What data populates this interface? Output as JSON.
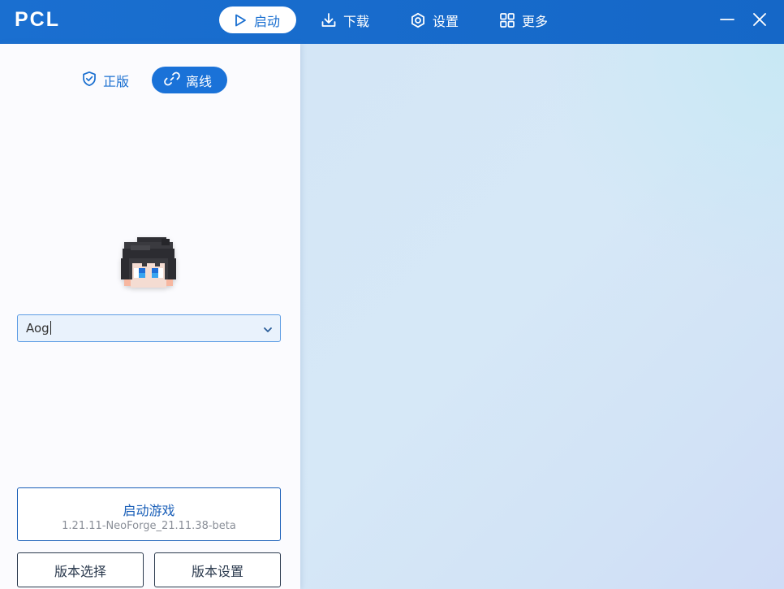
{
  "app": {
    "logo": "PCL"
  },
  "nav": {
    "items": [
      {
        "id": "launch",
        "label": "启动",
        "icon": "play-icon",
        "active": true
      },
      {
        "id": "download",
        "label": "下载",
        "icon": "download-icon",
        "active": false
      },
      {
        "id": "settings",
        "label": "设置",
        "icon": "gear-icon",
        "active": false
      },
      {
        "id": "more",
        "label": "更多",
        "icon": "grid-icon",
        "active": false
      }
    ]
  },
  "window_controls": {
    "minimize_icon": "minimize-icon",
    "close_icon": "close-icon"
  },
  "login": {
    "tabs": [
      {
        "id": "official",
        "label": "正版",
        "icon": "shield-check-icon",
        "active": false
      },
      {
        "id": "offline",
        "label": "离线",
        "icon": "link-icon",
        "active": true
      }
    ],
    "avatar_icon": "player-head-icon",
    "username": {
      "value": "Aog",
      "icon": "chevron-down-icon"
    }
  },
  "actions": {
    "launch": {
      "title": "启动游戏",
      "version": "1.21.11-NeoForge_21.11.38-beta"
    },
    "version_select": "版本选择",
    "version_settings": "版本设置"
  },
  "colors": {
    "accent": "#1a6fd0",
    "titlebar": "#1a6fd0",
    "panel_bg": "#fbfbfe",
    "background": "#d4e6f6"
  }
}
